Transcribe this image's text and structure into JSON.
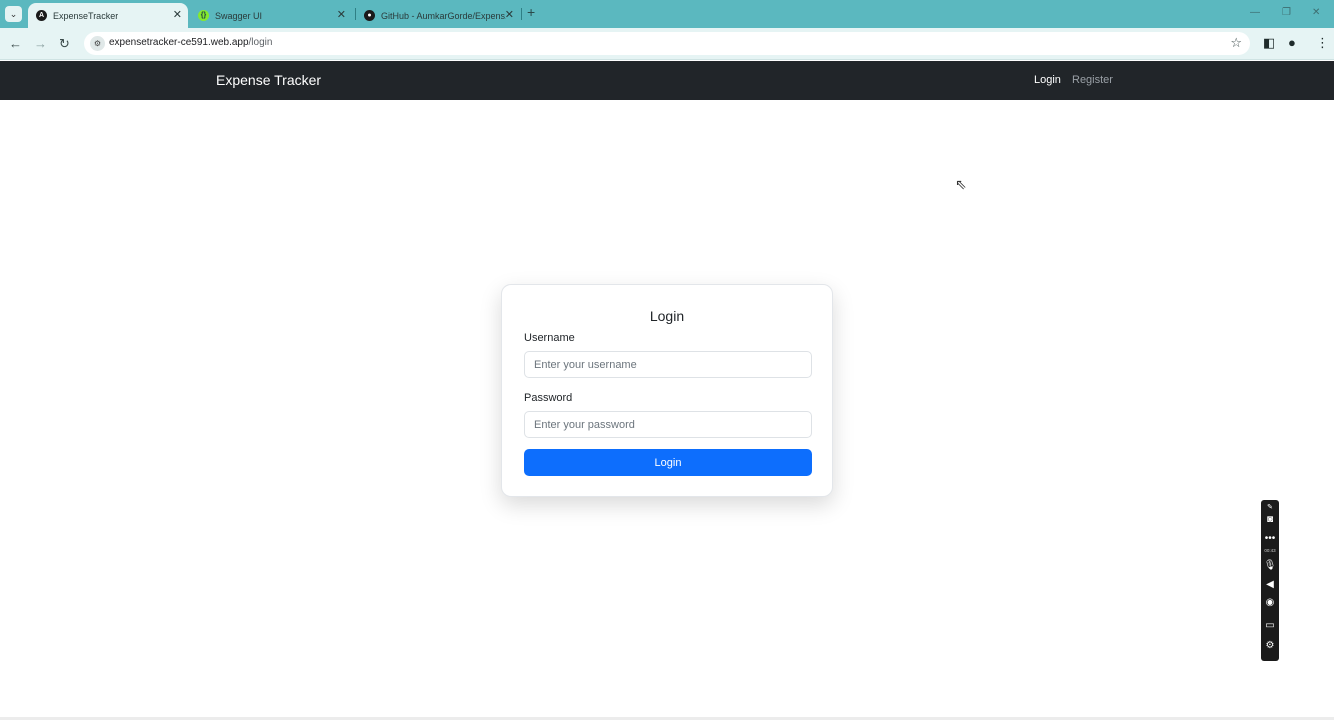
{
  "browser": {
    "tabs": [
      {
        "title": "ExpenseTracker",
        "favicon": "angular-icon",
        "favicon_color": "#1a1a1a",
        "active": true
      },
      {
        "title": "Swagger UI",
        "favicon": "swagger-icon",
        "favicon_color": "#85ea2d",
        "active": false
      },
      {
        "title": "GitHub - AumkarGorde/Expens...",
        "favicon": "github-icon",
        "favicon_color": "#1a1a1a",
        "active": false
      }
    ],
    "new_tab_label": "+",
    "url": {
      "host": "expensetracker-ce591.web.app",
      "path": "/login"
    }
  },
  "navbar": {
    "brand": "Expense Tracker",
    "links": {
      "login": "Login",
      "register": "Register"
    },
    "background": "#212529"
  },
  "login_card": {
    "title": "Login",
    "username_label": "Username",
    "username_placeholder": "Enter your username",
    "password_label": "Password",
    "password_placeholder": "Enter your password",
    "submit_label": "Login",
    "button_color": "#0d6efd"
  },
  "recorder": {
    "timer": "00:43"
  }
}
